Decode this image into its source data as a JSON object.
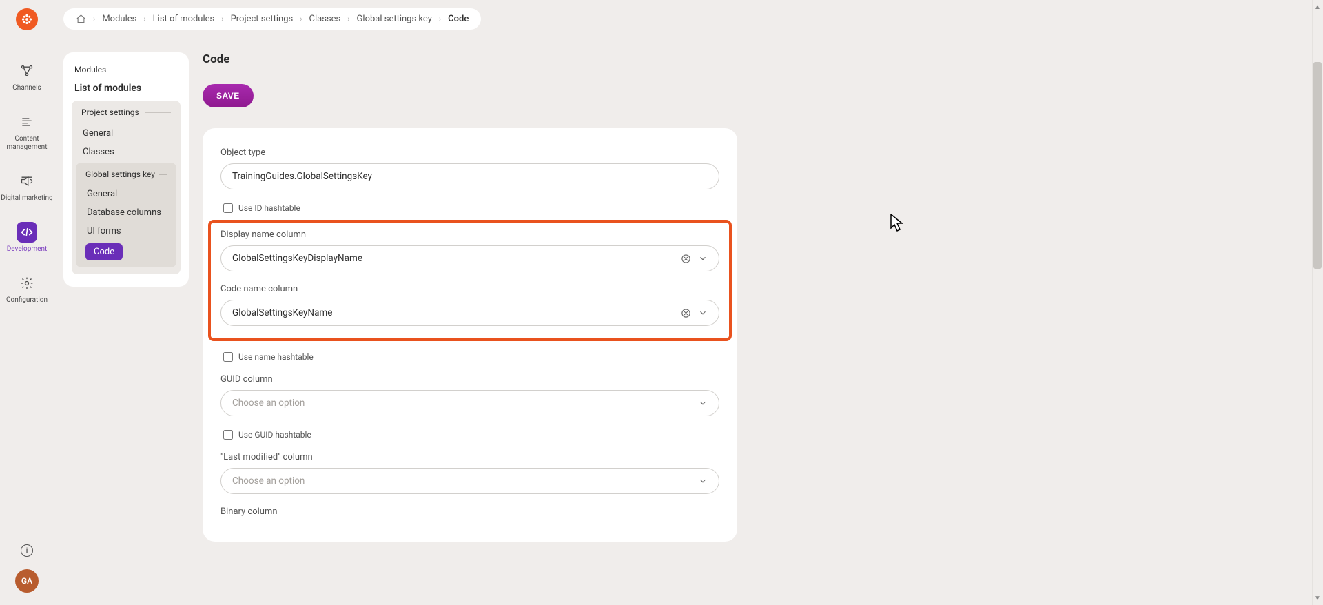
{
  "brand_color": "#f05a22",
  "accent_color": "#6a2eb8",
  "highlight_color": "#e9521e",
  "rail": {
    "items": [
      {
        "label": "Channels",
        "icon": "channels-icon",
        "active": false
      },
      {
        "label": "Content management",
        "icon": "content-icon",
        "active": false
      },
      {
        "label": "Digital marketing",
        "icon": "marketing-icon",
        "active": false
      },
      {
        "label": "Development",
        "icon": "code-icon",
        "active": true
      },
      {
        "label": "Configuration",
        "icon": "gear-icon",
        "active": false
      }
    ],
    "avatar_initials": "GA"
  },
  "breadcrumb": {
    "items": [
      "Modules",
      "List of modules",
      "Project settings",
      "Classes",
      "Global settings key",
      "Code"
    ]
  },
  "tree": {
    "group_label": "Modules",
    "title": "List of modules",
    "project_settings_label": "Project settings",
    "items_level1": [
      "General",
      "Classes"
    ],
    "global_settings_label": "Global settings key",
    "items_level2": [
      "General",
      "Database columns",
      "UI forms"
    ],
    "current": "Code"
  },
  "page": {
    "title": "Code",
    "save_label": "SAVE"
  },
  "form": {
    "object_type": {
      "label": "Object type",
      "value": "TrainingGuides.GlobalSettingsKey"
    },
    "use_id_hashtable": {
      "label": "Use ID hashtable",
      "checked": false
    },
    "display_name_column": {
      "label": "Display name column",
      "value": "GlobalSettingsKeyDisplayName"
    },
    "code_name_column": {
      "label": "Code name column",
      "value": "GlobalSettingsKeyName"
    },
    "use_name_hashtable": {
      "label": "Use name hashtable",
      "checked": false
    },
    "guid_column": {
      "label": "GUID column",
      "placeholder": "Choose an option",
      "value": ""
    },
    "use_guid_hashtable": {
      "label": "Use GUID hashtable",
      "checked": false
    },
    "last_modified_column": {
      "label": "\"Last modified\" column",
      "placeholder": "Choose an option",
      "value": ""
    },
    "binary_column": {
      "label": "Binary column"
    }
  }
}
